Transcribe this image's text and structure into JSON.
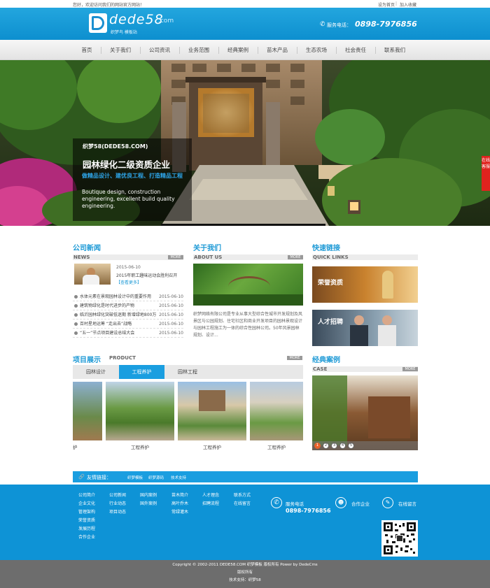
{
  "topbar": {
    "welcome": "您好，欢迎访问我们的网站官方网站！",
    "set_home": "设为首页",
    "add_fav": "加入收藏",
    "sep": "|"
  },
  "header": {
    "logo_text": "dede58",
    "logo_domain": ".com",
    "logo_sub": "织梦鸟 模板站",
    "phone_label": "服务电话：",
    "phone": "0898-7976856"
  },
  "nav": [
    "首页",
    "关于我们",
    "公司资讯",
    "业务范围",
    "经典案例",
    "苗木产品",
    "生态农场",
    "社会责任",
    "联系我们"
  ],
  "banner": {
    "brand": "织梦58(DEDE58.COM)",
    "headline": "园林绿化二级资质企业",
    "tagline": "做精品设计、建优良工程、打造精品工程",
    "english": "Boutique design, construction engineering, excellent build quality engineering.",
    "side_tab": "在线客服"
  },
  "news": {
    "title": "公司新闻",
    "en": "NEWS",
    "more": "MORE",
    "feature_date": "2015-06-10",
    "feature_title": "2015年职工趣味运动会胜利召开",
    "feature_link": "【查看更多】",
    "items": [
      {
        "t": "水体元素在景观园林设计中的重要作用",
        "d": "2015-06-10"
      },
      {
        "t": "建筑物绿化是时代进步的产物",
        "d": "2015-06-10"
      },
      {
        "t": "临沂园林绿化突破低迷期 新增绿地800万",
        "d": "2015-06-10"
      },
      {
        "t": "百村星地运筹 “走出去”战略",
        "d": "2015-06-10"
      },
      {
        "t": "“五一”节点项目建设总结大会",
        "d": "2015-06-10"
      }
    ]
  },
  "about": {
    "title": "关于我们",
    "en": "ABOUT US",
    "more": "MORE",
    "text": "织梦网络有限公司是专业从事大型综合性城市开发规划及风景区与公园规划、住宅社区和商业开发项目的园林景观设计与园林工程施工为一体的综合性园林公司。50年风景园林规划、设计..."
  },
  "quick": {
    "title": "快速链接",
    "en": "QUICK LINKS",
    "item1": "荣誉资质",
    "item2": "人才招聘"
  },
  "product": {
    "title": "项目展示",
    "en": "PRODUCT",
    "more": "MORE",
    "tabs": [
      "园林设计",
      "工程养护",
      "园林工程"
    ],
    "captions": [
      "护",
      "工程养护",
      "工程养护",
      "工程养护"
    ]
  },
  "case": {
    "title": "经典案例",
    "en": "CASE",
    "more": "MORE",
    "pages": [
      "1",
      "2",
      "3",
      "4",
      "5"
    ]
  },
  "links": {
    "label": "友情链接：",
    "items": [
      "织梦模板",
      "织梦源码",
      "技术支持"
    ]
  },
  "footer": {
    "col1": [
      "公司简介",
      "企业文化",
      "管理架构",
      "荣誉资质",
      "发展历程",
      "合作企业"
    ],
    "col2": [
      "公司新闻",
      "行业动态",
      "项目动态"
    ],
    "col3": [
      "国内案例",
      "国外案例"
    ],
    "col4": [
      "苗木简介",
      "高叶乔木",
      "常绿灌木"
    ],
    "col5": [
      "人才理念",
      "招聘流程"
    ],
    "col6": [
      "联系方式",
      "在线留言"
    ],
    "service_label": "服务电话",
    "service_phone": "0898-7976856",
    "coop": "合作企业",
    "online_msg": "在线留言"
  },
  "copyright": {
    "line1": "Copyright © 2002-2011 DEDE58.COM 织梦模板 版权所有 Power by DedeCms",
    "line2": "版权所有",
    "line3": "技术支持：织梦58"
  },
  "colors": {
    "accent": "#1a9ee0",
    "footer_bg": "#0e93d6",
    "copyright_bg": "#6d6d6d"
  }
}
